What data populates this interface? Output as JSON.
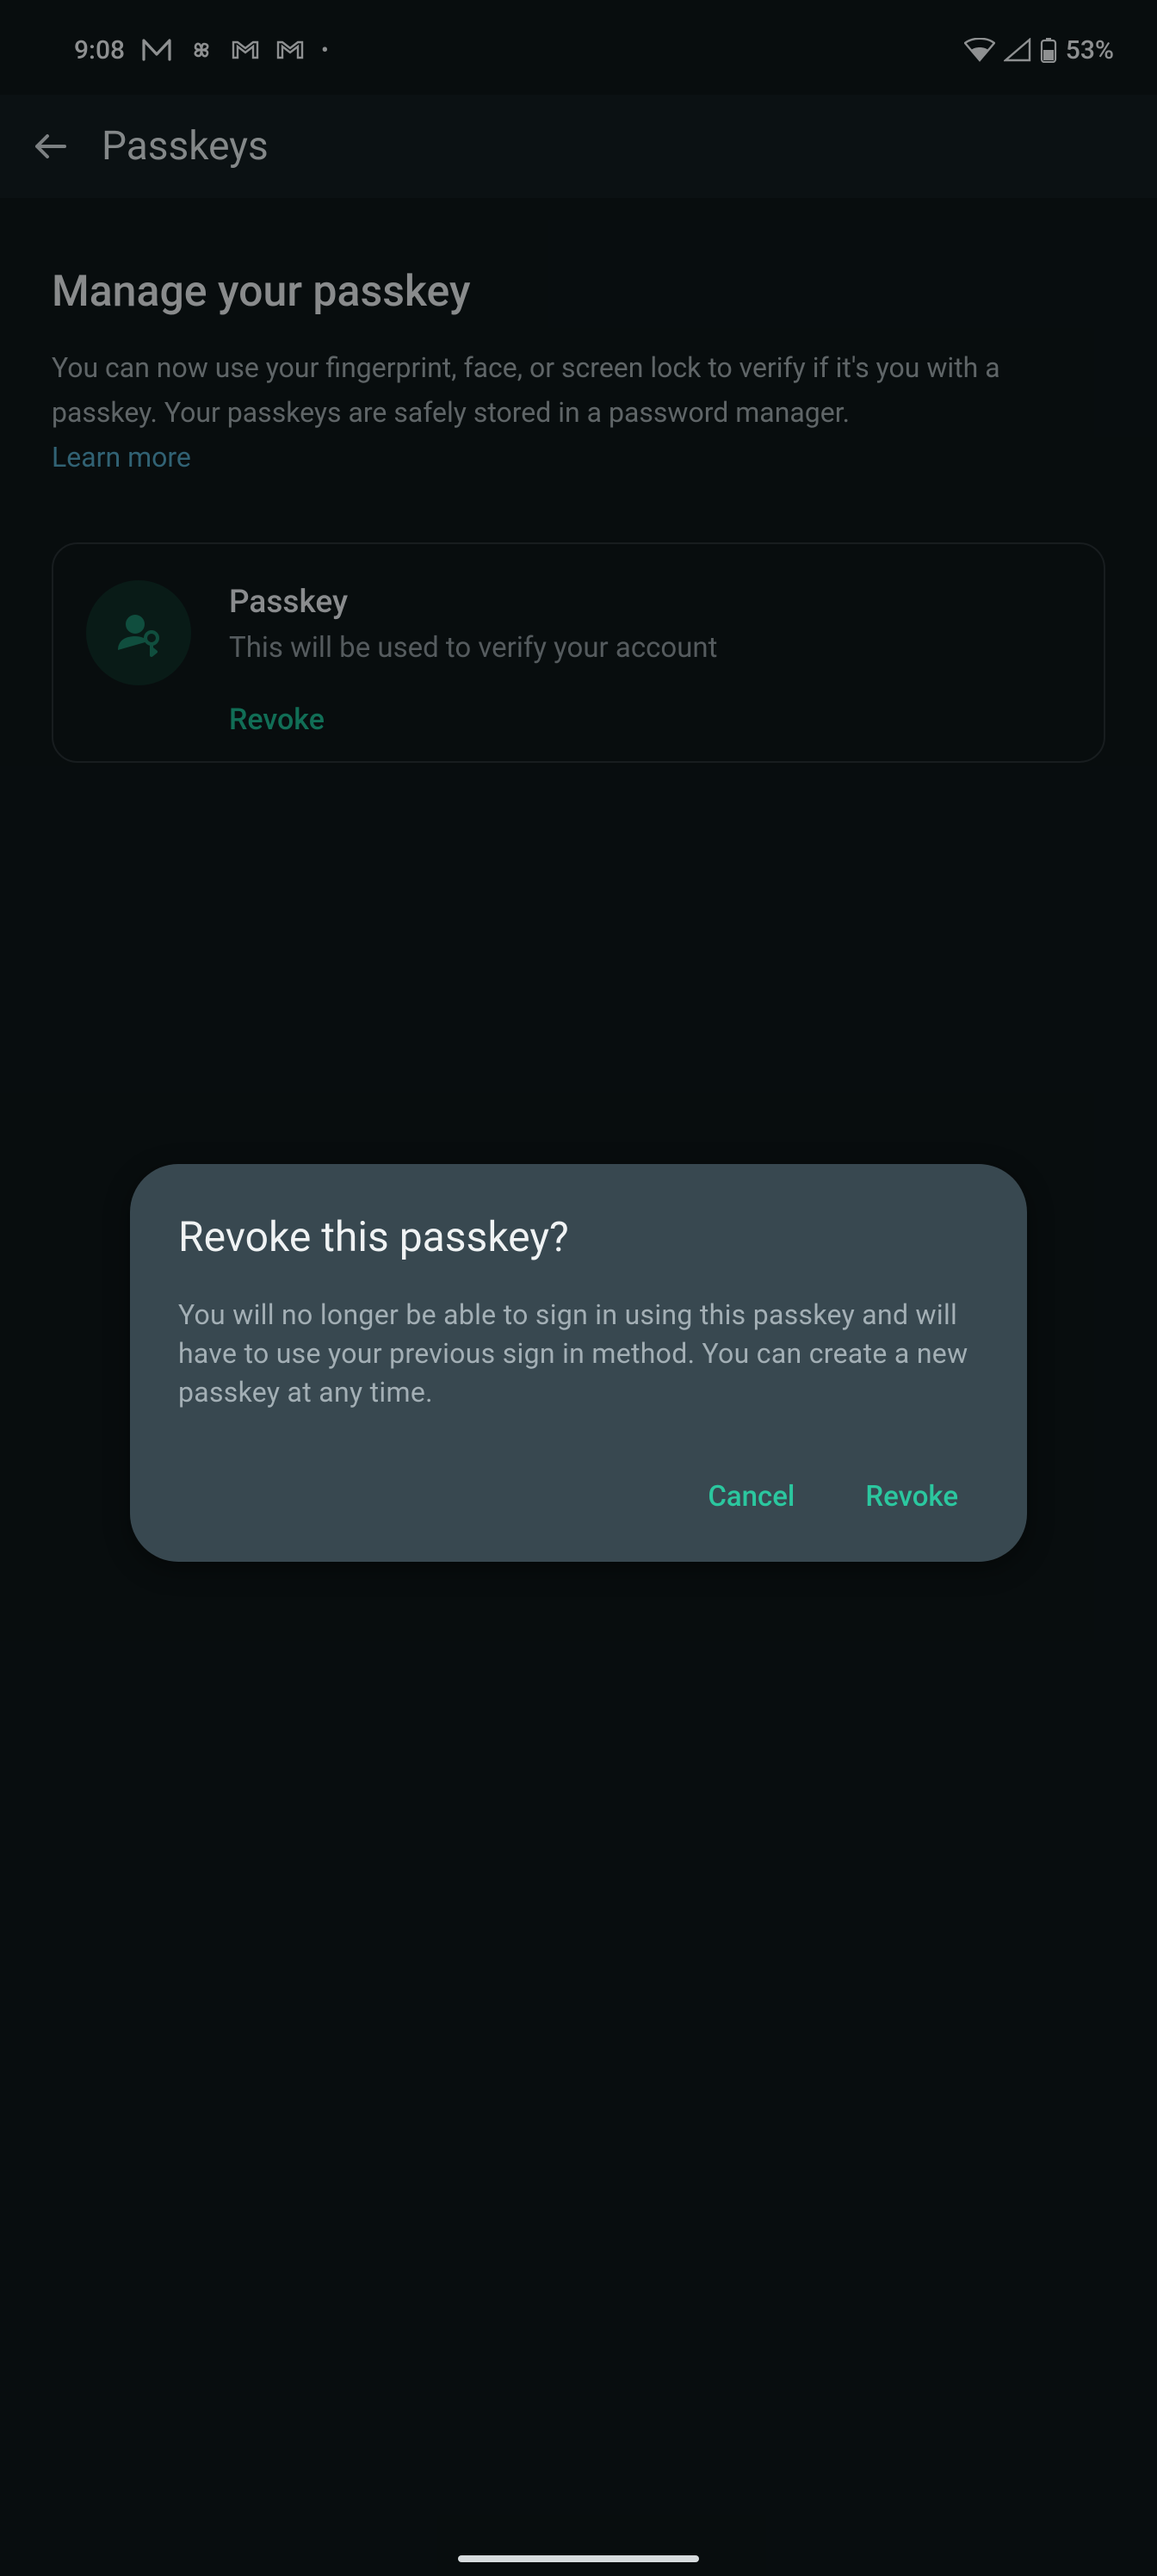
{
  "status": {
    "time": "9:08",
    "battery": "53%"
  },
  "appbar": {
    "title": "Passkeys"
  },
  "page": {
    "heading": "Manage your passkey",
    "description": "You can now use your fingerprint, face, or screen lock to verify if it's you with a passkey. Your passkeys are safely stored in a password manager.",
    "learn_more": "Learn more"
  },
  "card": {
    "title": "Passkey",
    "description": "This will be used to verify your account",
    "action": "Revoke"
  },
  "dialog": {
    "title": "Revoke this passkey?",
    "body": "You will no longer be able to sign in using this passkey and will have to use your previous sign in method. You can create a new passkey at any time.",
    "cancel": "Cancel",
    "confirm": "Revoke"
  }
}
